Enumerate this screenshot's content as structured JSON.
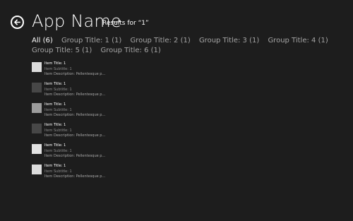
{
  "header": {
    "app_title": "App Name",
    "results_label": "Results for “1”",
    "back_icon": "back-arrow-icon"
  },
  "filters": [
    {
      "label": "All (6)",
      "active": true
    },
    {
      "label": "Group Title: 1 (1)",
      "active": false
    },
    {
      "label": "Group Title: 2 (1)",
      "active": false
    },
    {
      "label": "Group Title: 3 (1)",
      "active": false
    },
    {
      "label": "Group Title: 4 (1)",
      "active": false
    },
    {
      "label": "Group Title: 5 (1)",
      "active": false
    },
    {
      "label": "Group Title: 6 (1)",
      "active": false
    }
  ],
  "results": [
    {
      "title": "Item Title: 1",
      "subtitle": "Item Subtitle: 1",
      "description": "Item Description: Pellentesque p...",
      "thumb_color": "#dcdcdc"
    },
    {
      "title": "Item Title: 1",
      "subtitle": "Item Subtitle: 1",
      "description": "Item Description: Pellentesque p...",
      "thumb_color": "#474747"
    },
    {
      "title": "Item Title: 1",
      "subtitle": "Item Subtitle: 1",
      "description": "Item Description: Pellentesque p...",
      "thumb_color": "#9c9c9c"
    },
    {
      "title": "Item Title: 1",
      "subtitle": "Item Subtitle: 1",
      "description": "Item Description: Pellentesque p...",
      "thumb_color": "#474747"
    },
    {
      "title": "Item Title: 1",
      "subtitle": "Item Subtitle: 1",
      "description": "Item Description: Pellentesque p...",
      "thumb_color": "#e2e2e2"
    },
    {
      "title": "Item Title: 1",
      "subtitle": "Item Subtitle: 1",
      "description": "Item Description: Pellentesque p...",
      "thumb_color": "#dcdcdc"
    }
  ]
}
